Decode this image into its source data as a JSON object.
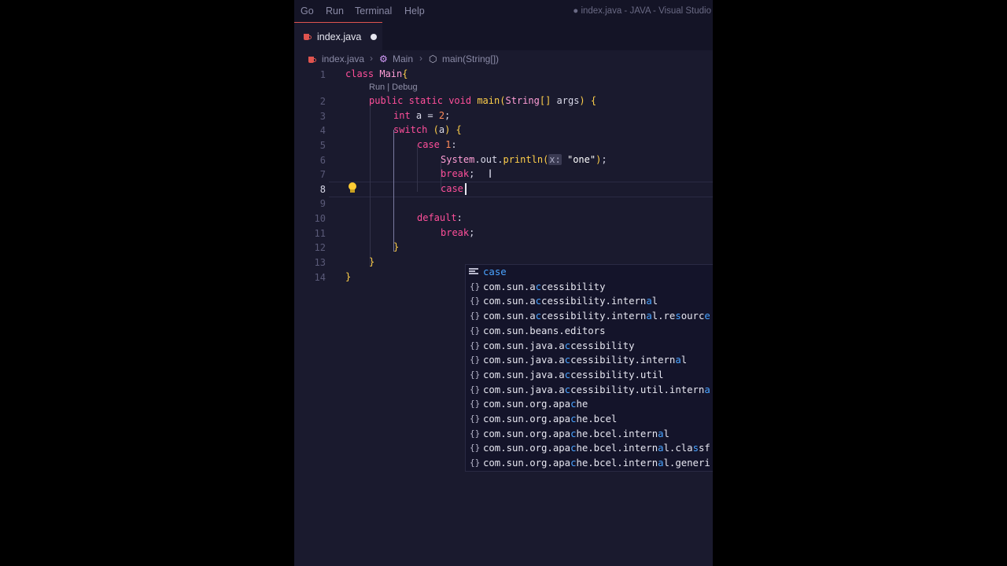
{
  "menu": [
    "Go",
    "Run",
    "Terminal",
    "Help"
  ],
  "window_title": "● index.java - JAVA - Visual Studio",
  "tab": {
    "label": "index.java",
    "modified": true
  },
  "breadcrumb": [
    "index.java",
    "Main",
    "main(String[])"
  ],
  "codelens": "Run | Debug",
  "line_numbers": [
    "1",
    "2",
    "3",
    "4",
    "5",
    "6",
    "7",
    "8",
    "9",
    "10",
    "11",
    "12",
    "13",
    "14"
  ],
  "active_line": "8",
  "code_lines": [
    "class Main{",
    "public static void main(String[] args) {",
    "int a = 2;",
    "switch (a) {",
    "case 1:",
    "System.out.println(x: \"one\");",
    "break;",
    "case",
    "",
    "default:",
    "break;",
    "}",
    "}",
    "}"
  ],
  "param_hint": "x:",
  "suggestions": [
    {
      "icon": "keyword-icon",
      "label": "case"
    },
    {
      "icon": "module-icon",
      "label": "com.sun.accessibility"
    },
    {
      "icon": "module-icon",
      "label": "com.sun.accessibility.internal"
    },
    {
      "icon": "module-icon",
      "label": "com.sun.accessibility.internal.resource"
    },
    {
      "icon": "module-icon",
      "label": "com.sun.beans.editors"
    },
    {
      "icon": "module-icon",
      "label": "com.sun.java.accessibility"
    },
    {
      "icon": "module-icon",
      "label": "com.sun.java.accessibility.internal"
    },
    {
      "icon": "module-icon",
      "label": "com.sun.java.accessibility.util"
    },
    {
      "icon": "module-icon",
      "label": "com.sun.java.accessibility.util.interna"
    },
    {
      "icon": "module-icon",
      "label": "com.sun.org.apache"
    },
    {
      "icon": "module-icon",
      "label": "com.sun.org.apache.bcel"
    },
    {
      "icon": "module-icon",
      "label": "com.sun.org.apache.bcel.internal"
    },
    {
      "icon": "module-icon",
      "label": "com.sun.org.apache.bcel.internal.classf"
    },
    {
      "icon": "module-icon",
      "label": "com.sun.org.apache.bcel.internal.generi"
    }
  ],
  "colors": {
    "background": "#1a1a2e",
    "keyword": "#ff4f9a",
    "function": "#ffcf4a",
    "match": "#4aa3ff",
    "tab_accent": "#e0544f"
  }
}
